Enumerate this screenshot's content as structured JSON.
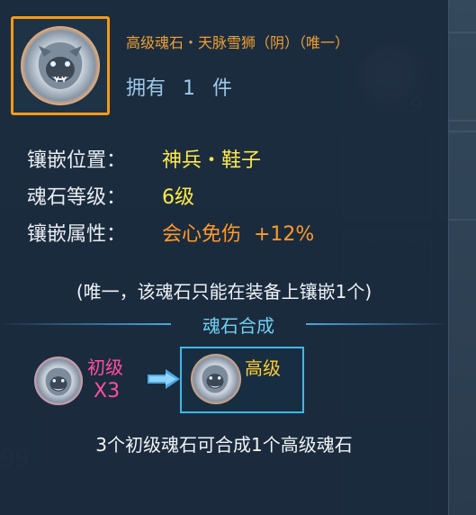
{
  "item": {
    "title": "高级魂石・天脉雪狮（阴）（唯一）",
    "own_prefix": "拥有",
    "own_count": "1",
    "own_unit": "件",
    "icon": "snow-lion-soul-stone-icon"
  },
  "attributes": [
    {
      "label": "镶嵌位置：",
      "value": "神兵・鞋子",
      "color": "#ffe94a"
    },
    {
      "label": "魂石等级：",
      "value": "6级",
      "color": "#ffe94a"
    },
    {
      "label": "镶嵌属性：",
      "value": "会心免伤  +12%",
      "color": "#ff9a2a"
    }
  ],
  "note": "(唯一，该魂石只能在装备上镶嵌1个)",
  "synthesis": {
    "title": "魂石合成",
    "source_level": "初级",
    "source_count": "X3",
    "result_level": "高级",
    "summary": "3个初级魂石可合成1个高级魂石"
  },
  "background": {
    "inventory_count": "9",
    "left_count": "99"
  },
  "colors": {
    "title_orange": "#f0a032",
    "value_yellow": "#ffe94a",
    "value_orange": "#ff9a2a",
    "section_cyan": "#6fd0f0",
    "low_pink": "#ff4fa0",
    "high_gold": "#ffcc33",
    "frame_orange": "#f29a1c"
  }
}
